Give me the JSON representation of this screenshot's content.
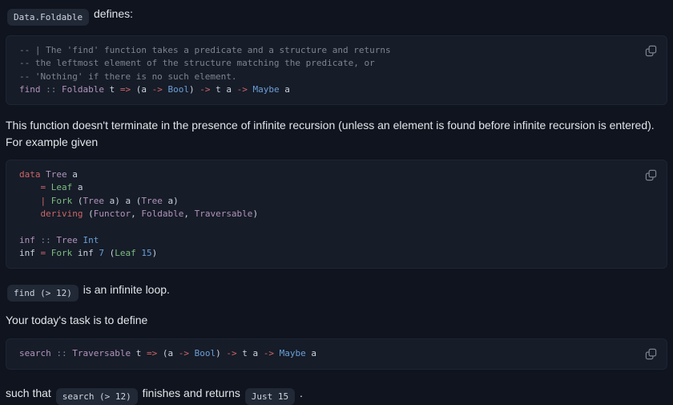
{
  "theme": {
    "page_bg": "#0f141e",
    "code_block_bg": "#161c28",
    "code_block_border": "#1e2533",
    "inline_code_bg": "#212836",
    "body_text": "#e1e5ea",
    "code_text": "#ccd3dc",
    "syntax_keyword_red": "#cc6666",
    "syntax_type_purple": "#b294bb",
    "syntax_constructor_green": "#7dbc81",
    "syntax_literal_blue": "#6a9fd8",
    "syntax_comment_gray": "#7d8590",
    "syntax_operator_gray": "#7b8496",
    "icon_gray": "#7a828e"
  },
  "icons": {
    "copy": "copy-icon"
  },
  "content": {
    "intro": {
      "tokens": [
        [
          "code",
          "Data.Foldable"
        ],
        [
          "text",
          " defines:"
        ]
      ]
    },
    "code_find": {
      "lines": [
        [
          [
            "comment",
            "-- | The 'find' function takes a predicate and a structure and returns"
          ]
        ],
        [
          [
            "comment",
            "-- the leftmost element of the structure matching the predicate, or"
          ]
        ],
        [
          [
            "comment",
            "-- 'Nothing' if there is no such element."
          ]
        ],
        [
          [
            "type",
            "find"
          ],
          [
            "plain",
            " "
          ],
          [
            "operator",
            "::"
          ],
          [
            "plain",
            " "
          ],
          [
            "type",
            "Foldable"
          ],
          [
            "plain",
            " t "
          ],
          [
            "keyword",
            "=>"
          ],
          [
            "plain",
            " (a "
          ],
          [
            "keyword",
            "->"
          ],
          [
            "plain",
            " "
          ],
          [
            "literal",
            "Bool"
          ],
          [
            "plain",
            ") "
          ],
          [
            "keyword",
            "->"
          ],
          [
            "plain",
            " t a "
          ],
          [
            "keyword",
            "->"
          ],
          [
            "plain",
            " "
          ],
          [
            "literal",
            "Maybe"
          ],
          [
            "plain",
            " a"
          ]
        ]
      ]
    },
    "para_recursion": {
      "lines": [
        [
          [
            "text",
            "This function doesn't terminate in the presence of infinite recursion (unless an element is found before infinite recursion is entered)."
          ]
        ],
        [
          [
            "text",
            "For example given"
          ]
        ]
      ]
    },
    "code_tree": {
      "lines": [
        [
          [
            "keyword",
            "data"
          ],
          [
            "plain",
            " "
          ],
          [
            "type",
            "Tree"
          ],
          [
            "plain",
            " a"
          ]
        ],
        [
          [
            "plain",
            "    "
          ],
          [
            "keyword",
            "="
          ],
          [
            "plain",
            " "
          ],
          [
            "constructor",
            "Leaf"
          ],
          [
            "plain",
            " a"
          ]
        ],
        [
          [
            "plain",
            "    "
          ],
          [
            "keyword",
            "|"
          ],
          [
            "plain",
            " "
          ],
          [
            "constructor",
            "Fork"
          ],
          [
            "plain",
            " ("
          ],
          [
            "type",
            "Tree"
          ],
          [
            "plain",
            " a) a ("
          ],
          [
            "type",
            "Tree"
          ],
          [
            "plain",
            " a)"
          ]
        ],
        [
          [
            "plain",
            "    "
          ],
          [
            "keyword",
            "deriving"
          ],
          [
            "plain",
            " ("
          ],
          [
            "type",
            "Functor"
          ],
          [
            "plain",
            ", "
          ],
          [
            "type",
            "Foldable"
          ],
          [
            "plain",
            ", "
          ],
          [
            "type",
            "Traversable"
          ],
          [
            "plain",
            ")"
          ]
        ],
        [],
        [
          [
            "type",
            "inf"
          ],
          [
            "plain",
            " "
          ],
          [
            "operator",
            "::"
          ],
          [
            "plain",
            " "
          ],
          [
            "type",
            "Tree"
          ],
          [
            "plain",
            " "
          ],
          [
            "literal",
            "Int"
          ]
        ],
        [
          [
            "plain",
            "inf "
          ],
          [
            "keyword",
            "="
          ],
          [
            "plain",
            " "
          ],
          [
            "constructor",
            "Fork"
          ],
          [
            "plain",
            " inf "
          ],
          [
            "literal",
            "7"
          ],
          [
            "plain",
            " ("
          ],
          [
            "constructor",
            "Leaf"
          ],
          [
            "plain",
            " "
          ],
          [
            "literal",
            "15"
          ],
          [
            "plain",
            ")"
          ]
        ]
      ]
    },
    "loop_line": {
      "tokens": [
        [
          "code",
          "find (> 12)"
        ],
        [
          "text",
          " is an infinite loop."
        ]
      ]
    },
    "task_line": {
      "tokens": [
        [
          "text",
          "Your today's task is to define"
        ]
      ]
    },
    "code_search": {
      "lines": [
        [
          [
            "type",
            "search"
          ],
          [
            "plain",
            " "
          ],
          [
            "operator",
            "::"
          ],
          [
            "plain",
            " "
          ],
          [
            "type",
            "Traversable"
          ],
          [
            "plain",
            " t "
          ],
          [
            "keyword",
            "=>"
          ],
          [
            "plain",
            " (a "
          ],
          [
            "keyword",
            "->"
          ],
          [
            "plain",
            " "
          ],
          [
            "literal",
            "Bool"
          ],
          [
            "plain",
            ") "
          ],
          [
            "keyword",
            "->"
          ],
          [
            "plain",
            " t a "
          ],
          [
            "keyword",
            "->"
          ],
          [
            "plain",
            " "
          ],
          [
            "literal",
            "Maybe"
          ],
          [
            "plain",
            " a"
          ]
        ]
      ]
    },
    "final_line": {
      "tokens": [
        [
          "text",
          "such that "
        ],
        [
          "code",
          "search (> 12)"
        ],
        [
          "text",
          " finishes and returns "
        ],
        [
          "code",
          "Just 15"
        ],
        [
          "text",
          " ."
        ]
      ]
    }
  }
}
